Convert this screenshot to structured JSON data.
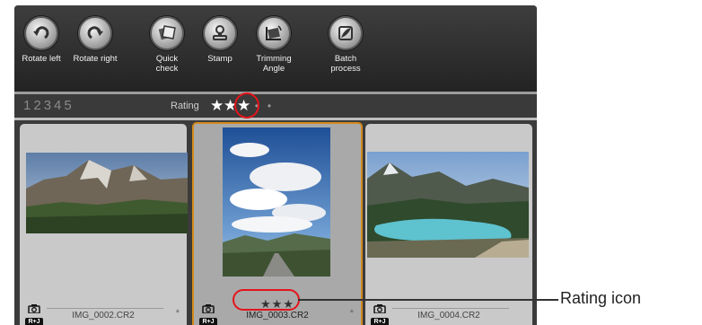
{
  "toolbar": {
    "tools": [
      {
        "label": "Rotate left",
        "icon": "rotate-left-icon"
      },
      {
        "label": "Rotate right",
        "icon": "rotate-right-icon"
      },
      {
        "label": "Quick\ncheck",
        "icon": "quick-check-icon"
      },
      {
        "label": "Stamp",
        "icon": "stamp-icon"
      },
      {
        "label": "Trimming\nAngle",
        "icon": "trimming-angle-icon"
      },
      {
        "label": "Batch\nprocess",
        "icon": "batch-process-icon"
      }
    ]
  },
  "rating_bar": {
    "numbers": [
      "1",
      "2",
      "3",
      "4",
      "5"
    ],
    "label": "Rating",
    "stars_filled": 3,
    "stars_total": 5,
    "star_glyph": "★",
    "dot_glyph": "•"
  },
  "thumbnails": [
    {
      "filename": "IMG_0002.CR2",
      "badge": "R+J",
      "mark": "*",
      "selected": false,
      "rating": ""
    },
    {
      "filename": "IMG_0003.CR2",
      "badge": "R+J",
      "mark": "*",
      "selected": true,
      "rating": "★★★"
    },
    {
      "filename": "IMG_0004.CR2",
      "badge": "R+J",
      "mark": "",
      "selected": false,
      "rating": ""
    }
  ],
  "annotation": {
    "label": "Rating icon",
    "color": "#e4141b"
  }
}
